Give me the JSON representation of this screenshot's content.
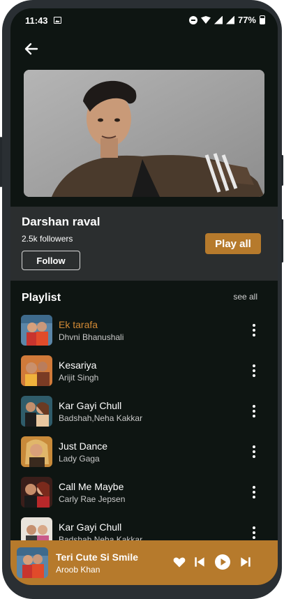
{
  "status": {
    "time": "11:43",
    "battery": "77%"
  },
  "artist": {
    "name": "Darshan raval",
    "followers": "2.5k followers",
    "follow_label": "Follow",
    "play_all_label": "Play all"
  },
  "playlist": {
    "title": "Playlist",
    "see_all": "see all",
    "songs": [
      {
        "title": "Ek tarafa",
        "artist": "Dhvni Bhanushali",
        "active": true
      },
      {
        "title": "Kesariya",
        "artist": "Arijit Singh",
        "active": false
      },
      {
        "title": "Kar Gayi Chull",
        "artist": "Badshah,Neha Kakkar",
        "active": false
      },
      {
        "title": "Just Dance",
        "artist": "Lady Gaga",
        "active": false
      },
      {
        "title": "Call Me Maybe",
        "artist": "Carly Rae Jepsen",
        "active": false
      },
      {
        "title": "Kar Gayi Chull",
        "artist": "Badshah,Neha Kakkar",
        "active": false
      }
    ]
  },
  "now_playing": {
    "title": "Teri Cute Si Smile",
    "artist": "Aroob Khan"
  },
  "colors": {
    "accent": "#b67a2c",
    "active_song": "#d38a35",
    "background": "#0e1512",
    "card": "#2b2e2f"
  },
  "icons": [
    "back-arrow-icon",
    "more-vert-icon",
    "heart-icon",
    "skip-previous-icon",
    "play-icon",
    "skip-next-icon"
  ]
}
